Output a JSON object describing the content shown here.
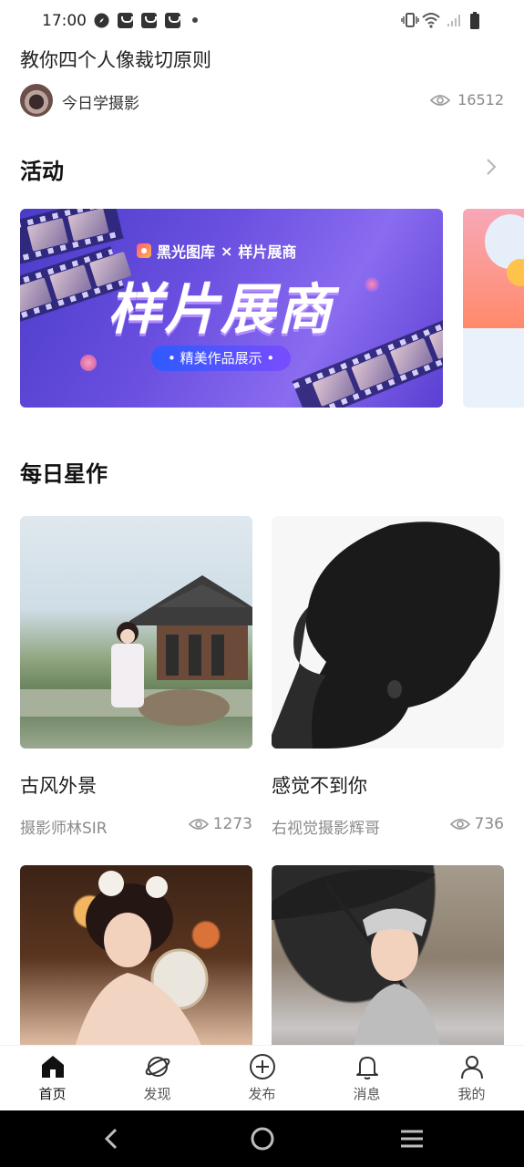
{
  "status_bar": {
    "time": "17:00",
    "icons": [
      "compass-icon",
      "mail-icon",
      "mail-icon",
      "mail-icon",
      "dot-icon"
    ],
    "right_icons": [
      "vibrate-icon",
      "wifi-icon",
      "signal-icon",
      "battery-icon"
    ]
  },
  "top_article": {
    "title": "教你四个人像裁切原则",
    "author": "今日学摄影",
    "views": "16512"
  },
  "activities": {
    "title": "活动",
    "banners": [
      {
        "brand_left": "黑光图库",
        "brand_sep": "×",
        "brand_right": "样片展商",
        "headline": "样片展商",
        "pill": "• 精美作品展示 •"
      }
    ]
  },
  "daily_stars": {
    "title": "每日星作",
    "cards": [
      {
        "title": "古风外景",
        "author": "摄影师林SIR",
        "views": "1273"
      },
      {
        "title": "感觉不到你",
        "author": "右视觉摄影辉哥",
        "views": "736"
      },
      {
        "title": "",
        "author": "",
        "views": ""
      },
      {
        "title": "",
        "author": "",
        "views": ""
      }
    ]
  },
  "bottom_nav": {
    "items": [
      {
        "label": "首页",
        "icon": "home-icon",
        "active": true
      },
      {
        "label": "发现",
        "icon": "planet-icon",
        "active": false
      },
      {
        "label": "发布",
        "icon": "plus-circle-icon",
        "active": false
      },
      {
        "label": "消息",
        "icon": "bell-icon",
        "active": false
      },
      {
        "label": "我的",
        "icon": "user-icon",
        "active": false
      }
    ]
  },
  "colors": {
    "accent": "#111111",
    "muted": "#8a8a8a",
    "banner_purple": "#5b3fd2"
  }
}
